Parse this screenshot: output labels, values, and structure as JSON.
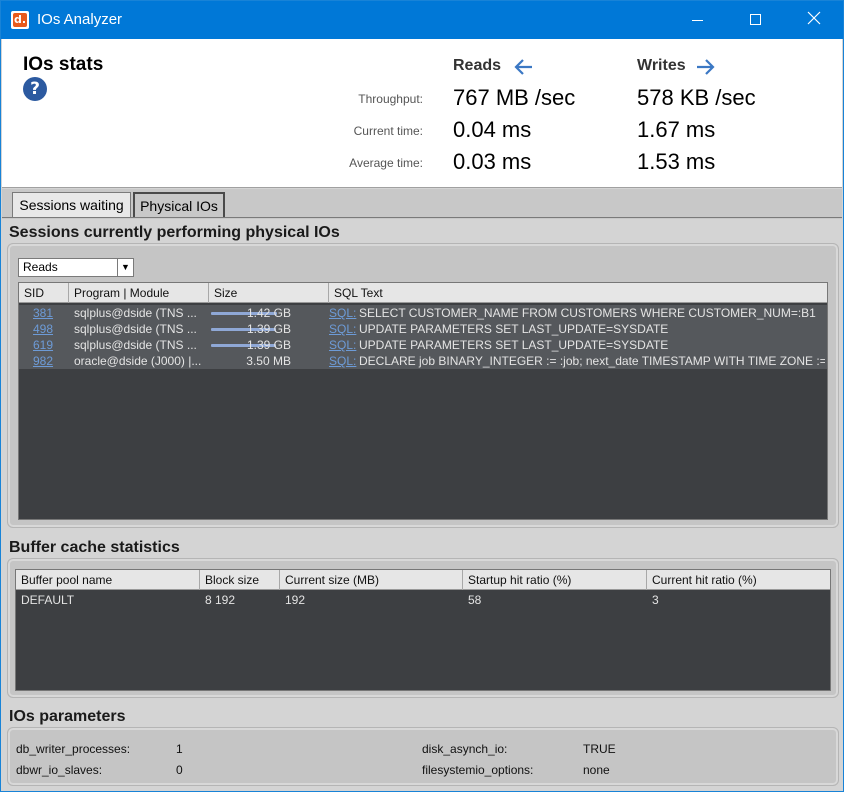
{
  "window": {
    "title": "IOs Analyzer",
    "icon_letter": "d."
  },
  "stats": {
    "title": "IOs stats",
    "reads_label": "Reads",
    "writes_label": "Writes",
    "rows": [
      {
        "label": "Throughput:",
        "reads": "767 MB /sec",
        "writes": "578 KB /sec"
      },
      {
        "label": "Current time:",
        "reads": "0.04 ms",
        "writes": "1.67 ms"
      },
      {
        "label": "Average time:",
        "reads": "0.03 ms",
        "writes": "1.53 ms"
      }
    ]
  },
  "tabs": [
    {
      "label": "Sessions waiting",
      "active": false
    },
    {
      "label": "Physical IOs",
      "active": true
    }
  ],
  "sessions": {
    "title": "Sessions currently performing physical IOs",
    "filter_value": "Reads",
    "columns": [
      "SID",
      "Program | Module",
      "Size",
      "SQL Text"
    ],
    "rows": [
      {
        "sid": "381",
        "program": "sqlplus@dside (TNS ...",
        "size": "1.42 GB",
        "size_fraction": 1.0,
        "sql_link": "SQL:",
        "sql": "SELECT CUSTOMER_NAME FROM CUSTOMERS WHERE CUSTOMER_NUM=:B1"
      },
      {
        "sid": "498",
        "program": "sqlplus@dside (TNS ...",
        "size": "1.39 GB",
        "size_fraction": 0.98,
        "sql_link": "SQL:",
        "sql": "UPDATE PARAMETERS SET LAST_UPDATE=SYSDATE"
      },
      {
        "sid": "619",
        "program": "sqlplus@dside (TNS ...",
        "size": "1.39 GB",
        "size_fraction": 0.98,
        "sql_link": "SQL:",
        "sql": "UPDATE PARAMETERS SET LAST_UPDATE=SYSDATE"
      },
      {
        "sid": "982",
        "program": "oracle@dside (J000) |...",
        "size": "3.50 MB",
        "size_fraction": 0.0,
        "sql_link": "SQL:",
        "sql": "DECLARE job BINARY_INTEGER := :job; next_date TIMESTAMP WITH TIME ZONE :="
      }
    ]
  },
  "buffer": {
    "title": "Buffer cache statistics",
    "columns": [
      "Buffer pool name",
      "Block size",
      "Current size (MB)",
      "Startup hit ratio (%)",
      "Current hit ratio (%)"
    ],
    "rows": [
      [
        "DEFAULT",
        "8 192",
        "192",
        "58",
        "3"
      ]
    ]
  },
  "params": {
    "title": "IOs parameters",
    "items": [
      {
        "name": "db_writer_processes:",
        "value": "1"
      },
      {
        "name": "dbwr_io_slaves:",
        "value": "0"
      },
      {
        "name": "disk_asynch_io:",
        "value": "TRUE"
      },
      {
        "name": "filesystemio_options:",
        "value": "none"
      }
    ]
  },
  "colors": {
    "titlebar": "#0078d7",
    "grid_bg": "#3d3f42",
    "link": "#6d9bd7",
    "bar": "#8fa8d6"
  }
}
